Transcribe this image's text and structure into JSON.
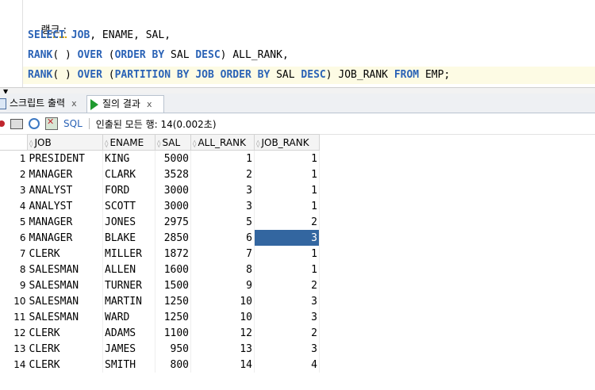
{
  "editor": {
    "title": "랭크 :",
    "lines": [
      [
        {
          "t": "SELECT",
          "k": true
        },
        {
          "t": " "
        },
        {
          "t": "JOB",
          "k": true
        },
        {
          "t": ", ENAME, SAL,"
        }
      ],
      [
        {
          "t": "RANK",
          "k": true
        },
        {
          "t": "( ) "
        },
        {
          "t": "OVER",
          "k": true
        },
        {
          "t": " ("
        },
        {
          "t": "ORDER BY",
          "k": true
        },
        {
          "t": " SAL "
        },
        {
          "t": "DESC",
          "k": true
        },
        {
          "t": ") ALL_RANK,"
        }
      ],
      [
        {
          "t": "RANK",
          "k": true
        },
        {
          "t": "( ) "
        },
        {
          "t": "OVER",
          "k": true
        },
        {
          "t": " ("
        },
        {
          "t": "PARTITION BY",
          "k": true
        },
        {
          "t": " "
        },
        {
          "t": "JOB",
          "k": true
        },
        {
          "t": " "
        },
        {
          "t": "ORDER BY",
          "k": true
        },
        {
          "t": " SAL "
        },
        {
          "t": "DESC",
          "k": true
        },
        {
          "t": ") JOB_RANK "
        },
        {
          "t": "FROM",
          "k": true
        },
        {
          "t": " EMP;"
        }
      ]
    ]
  },
  "tabs": {
    "script_output": "스크립트 출력",
    "query_result": "질의 결과",
    "close": "x"
  },
  "toolbar": {
    "sql_label": "SQL",
    "status": "인출된 모든 행: 14(0.002초)"
  },
  "grid": {
    "columns": [
      "JOB",
      "ENAME",
      "SAL",
      "ALL_RANK",
      "JOB_RANK"
    ],
    "rows": [
      [
        "1",
        "PRESIDENT",
        "KING",
        "5000",
        "1",
        "1"
      ],
      [
        "2",
        "MANAGER",
        "CLARK",
        "3528",
        "2",
        "1"
      ],
      [
        "3",
        "ANALYST",
        "FORD",
        "3000",
        "3",
        "1"
      ],
      [
        "4",
        "ANALYST",
        "SCOTT",
        "3000",
        "3",
        "1"
      ],
      [
        "5",
        "MANAGER",
        "JONES",
        "2975",
        "5",
        "2"
      ],
      [
        "6",
        "MANAGER",
        "BLAKE",
        "2850",
        "6",
        "3"
      ],
      [
        "7",
        "CLERK",
        "MILLER",
        "1872",
        "7",
        "1"
      ],
      [
        "8",
        "SALESMAN",
        "ALLEN",
        "1600",
        "8",
        "1"
      ],
      [
        "9",
        "SALESMAN",
        "TURNER",
        "1500",
        "9",
        "2"
      ],
      [
        "10",
        "SALESMAN",
        "MARTIN",
        "1250",
        "10",
        "3"
      ],
      [
        "11",
        "SALESMAN",
        "WARD",
        "1250",
        "10",
        "3"
      ],
      [
        "12",
        "CLERK",
        "ADAMS",
        "1100",
        "12",
        "2"
      ],
      [
        "13",
        "CLERK",
        "JAMES",
        "950",
        "13",
        "3"
      ],
      [
        "14",
        "CLERK",
        "SMITH",
        "800",
        "14",
        "4"
      ]
    ],
    "selected": {
      "row": 5,
      "col": 5
    }
  }
}
